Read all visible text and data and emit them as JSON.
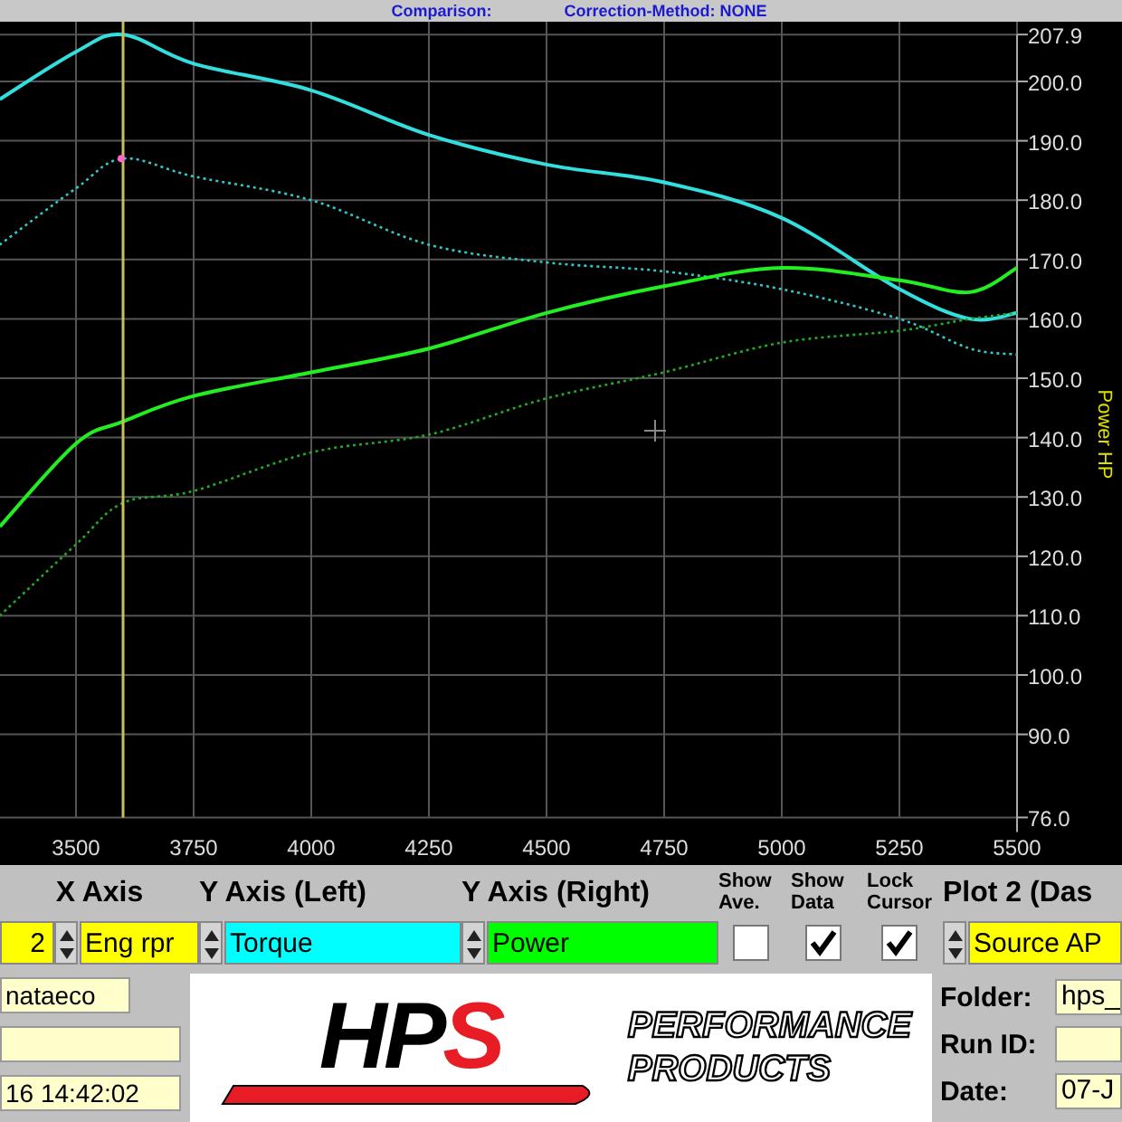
{
  "header": {
    "comparison": "Comparison:",
    "correction": "Correction-Method: NONE"
  },
  "chart": {
    "right_axis_label": "Power HP",
    "chart_data": {
      "type": "line",
      "grid": true,
      "ref_lines": [
        {
          "axis": "x",
          "value": 3600
        }
      ],
      "xlim": [
        3338,
        5500
      ],
      "ylim": [
        76,
        207.9
      ],
      "x": [
        3338,
        3500,
        3600,
        3750,
        4000,
        4250,
        4500,
        4750,
        5000,
        5250,
        5400,
        5500
      ],
      "series": [
        {
          "color": "#33dede",
          "line_style": "solid",
          "values": [
            197,
            205,
            207.9,
            203,
            198.5,
            191,
            186,
            183,
            177,
            165,
            160,
            161
          ]
        },
        {
          "color": "#33c8c8",
          "line_style": "dotted",
          "values": [
            172.5,
            182,
            187,
            184,
            180,
            172.5,
            169.5,
            168,
            165,
            160,
            155,
            154
          ]
        },
        {
          "color": "#22ee22",
          "line_style": "solid",
          "values": [
            125,
            139,
            142.7,
            147,
            151,
            155,
            161,
            165.5,
            168.6,
            166.5,
            164.5,
            168.6
          ]
        },
        {
          "color": "#22aa22",
          "line_style": "dotted",
          "values": [
            110,
            122,
            129,
            131,
            137.5,
            140.5,
            146.6,
            151,
            156,
            158,
            160,
            161
          ]
        }
      ],
      "xticks": [
        3500,
        3750,
        4000,
        4250,
        4500,
        4750,
        5000,
        5250,
        5500
      ],
      "yticks": [
        {
          "value": 207.9,
          "label": "207.9"
        },
        {
          "value": 200,
          "label": "200.0"
        },
        {
          "value": 190,
          "label": "190.0"
        },
        {
          "value": 180,
          "label": "180.0"
        },
        {
          "value": 170,
          "label": "170.0"
        },
        {
          "value": 160,
          "label": "160.0"
        },
        {
          "value": 150,
          "label": "150.0"
        },
        {
          "value": 140,
          "label": "140.0"
        },
        {
          "value": 130,
          "label": "130.0"
        },
        {
          "value": 120,
          "label": "120.0"
        },
        {
          "value": 110,
          "label": "110.0"
        },
        {
          "value": 100,
          "label": "100.0"
        },
        {
          "value": 90,
          "label": "90.0"
        },
        {
          "value": 76,
          "label": "76.0"
        }
      ]
    }
  },
  "plot1": {
    "value": "2",
    "color": "#ffff00"
  },
  "axes": [
    {
      "heading": "X Axis",
      "value": "Eng rpr",
      "color": "#ffff00"
    },
    {
      "heading": "Y Axis (Left)",
      "value": "Torque",
      "color": "#00ffff"
    },
    {
      "heading": "Y Axis (Right)",
      "value": "Power",
      "color": "#00ff00"
    }
  ],
  "toggles": [
    {
      "label": "Show Ave.",
      "checked": false
    },
    {
      "label": "Show Data",
      "checked": true
    },
    {
      "label": "Lock Cursor",
      "checked": true
    }
  ],
  "plot2": {
    "heading": "Plot 2 (Das",
    "value": "Source AP",
    "color": "#ffff00"
  },
  "info_left": {
    "field_1": "nataeco",
    "field_3": "16  14:42:02"
  },
  "logo": {
    "letters": "HP",
    "accent": "S",
    "lines": [
      "PERFORMANCE",
      "PRODUCTS"
    ]
  },
  "info_right": [
    {
      "label": "Folder:",
      "value": "hps_"
    },
    {
      "label": "Run ID:"
    },
    {
      "label": "Date:",
      "value": "07-J"
    }
  ]
}
